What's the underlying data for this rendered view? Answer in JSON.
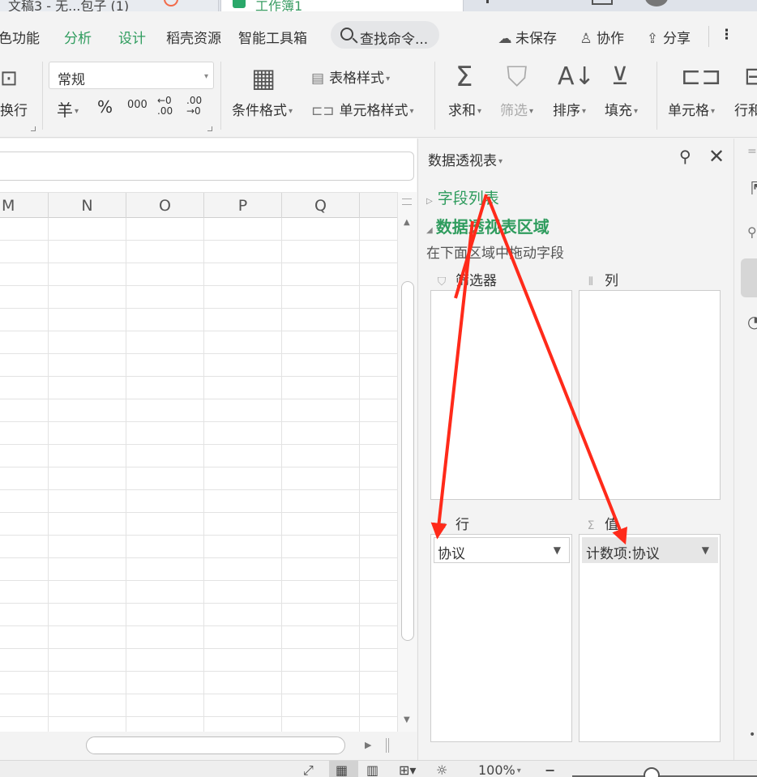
{
  "titlebar": {
    "tab1_label": "文稿3 - 无...包子 (1)",
    "tab2_label": "工作簿1"
  },
  "ribbon_tabs": {
    "items": [
      "色功能",
      "分析",
      "设计",
      "稻壳资源",
      "智能工具箱"
    ],
    "active_colored": [
      "分析",
      "设计"
    ],
    "search_placeholder": "查找命令...",
    "unsaved_label": "未保存",
    "collaborate_label": "协作",
    "share_label": "分享",
    "more_label": "⋮"
  },
  "ribbon": {
    "wrap_label": "换行",
    "number_format_value": "常规",
    "currency_symbol": "羊",
    "percent_symbol": "%",
    "thousands_symbol": "000",
    "dec_inc_symbol": "←0 .00",
    "dec_dec_symbol": ".00 →0",
    "conditional_format_label": "条件格式",
    "table_style_label": "表格样式",
    "cell_style_label": "单元格样式",
    "sum_label": "求和",
    "filter_label": "筛选",
    "sort_label": "排序",
    "fill_label": "填充",
    "cell_label": "单元格",
    "rowcol_label": "行和"
  },
  "sheet": {
    "columns": [
      "M",
      "N",
      "O",
      "P",
      "Q"
    ]
  },
  "pivot_panel": {
    "title": "数据透视表",
    "field_list_label": "字段列表",
    "area_label": "数据透视表区域",
    "hint": "在下面区域中拖动字段",
    "filter_zone_label": "筛选器",
    "column_zone_label": "列",
    "row_zone_label": "行",
    "value_zone_label": "值",
    "row_field": "协议",
    "value_field": "计数项:协议"
  },
  "statusbar": {
    "zoom": "100%"
  },
  "colors": {
    "accent_green": "#2f9c5e",
    "arrow_red": "#ff2a1a"
  }
}
